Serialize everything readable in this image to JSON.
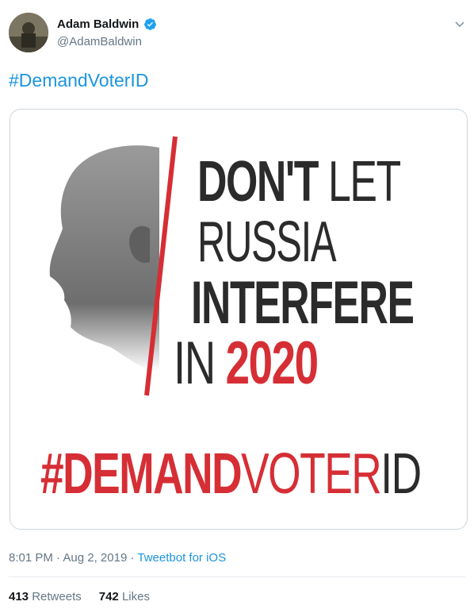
{
  "author": {
    "name": "Adam Baldwin",
    "handle": "@AdamBaldwin",
    "verified": true
  },
  "tweet": {
    "text": "#DemandVoterID",
    "poster": {
      "line1_bold": "DON'T",
      "line1_thin": "LET",
      "line2": "RUSSIA",
      "line3": "INTERFERE",
      "line4_thin": "IN",
      "line4_red": "2020",
      "hashtag_bold": "#DEMAND",
      "hashtag_red": "VOTER",
      "hashtag_thin": "ID"
    }
  },
  "meta": {
    "time": "8:01 PM",
    "separator": "·",
    "date": "Aug 2, 2019",
    "source": "Tweetbot for iOS"
  },
  "stats": {
    "retweets_count": "413",
    "retweets_label": "Retweets",
    "likes_count": "742",
    "likes_label": "Likes"
  },
  "colors": {
    "accent": "#1b95e0",
    "poster_red": "#d62e35",
    "poster_dark": "#2b2b2b"
  }
}
